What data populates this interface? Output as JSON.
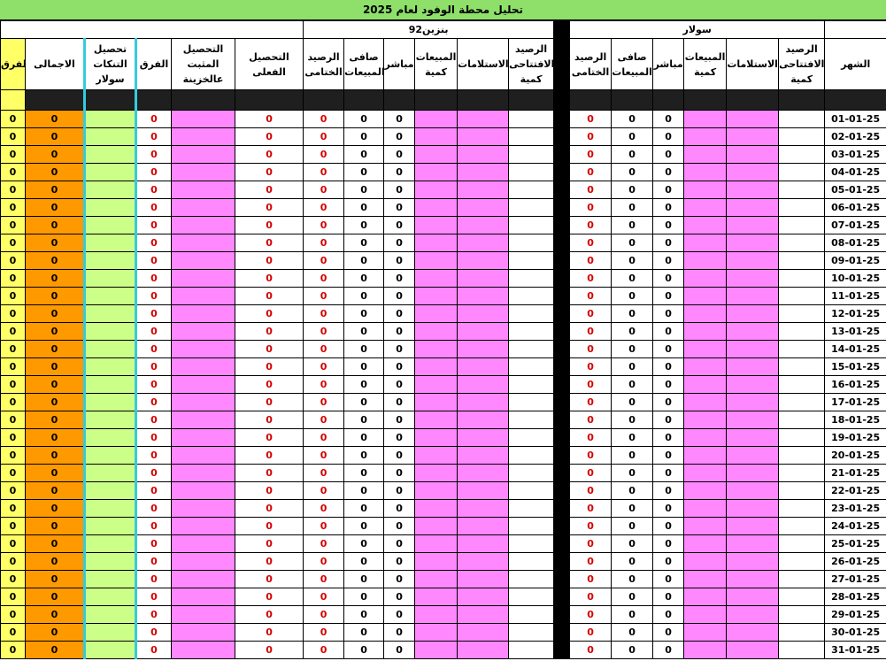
{
  "title": "تحليل محطة الوفود لعام 2025",
  "groups": {
    "benzine": "بنزين92",
    "solar": "سولار"
  },
  "headers": {
    "diff_short": "الفرق",
    "total": "الاجمالى",
    "collect_tanks_solar": "تحصيل التنكات سولار",
    "diff": "الفرق",
    "collect_treasury": "التحصيل المثبت عالخزينة",
    "collect_actual": "التحصيل الفعلى",
    "closing_balance": "الرصيد الختامى",
    "net_sales": "صافى المبيعات",
    "direct": "مباشر",
    "sales_qty": "المبيعات كمية",
    "receipts": "الاستلامات",
    "opening_balance_qty": "الرصيد الافتتاحى كمية",
    "month": "الشهر"
  },
  "zero": "0",
  "dates": [
    "01-01-25",
    "02-01-25",
    "03-01-25",
    "04-01-25",
    "05-01-25",
    "06-01-25",
    "07-01-25",
    "08-01-25",
    "09-01-25",
    "10-01-25",
    "11-01-25",
    "12-01-25",
    "13-01-25",
    "14-01-25",
    "15-01-25",
    "16-01-25",
    "17-01-25",
    "18-01-25",
    "19-01-25",
    "20-01-25",
    "21-01-25",
    "22-01-25",
    "23-01-25",
    "24-01-25",
    "25-01-25",
    "26-01-25",
    "27-01-25",
    "28-01-25",
    "29-01-25",
    "30-01-25",
    "31-01-25"
  ],
  "colors": {
    "title_bg": "#8ee06b",
    "yellow": "#ffff66",
    "orange": "#ff9900",
    "green": "#ccff88",
    "pink": "#ff88ff",
    "cyan_border": "#33ccdd",
    "red_value": "#d40000"
  }
}
